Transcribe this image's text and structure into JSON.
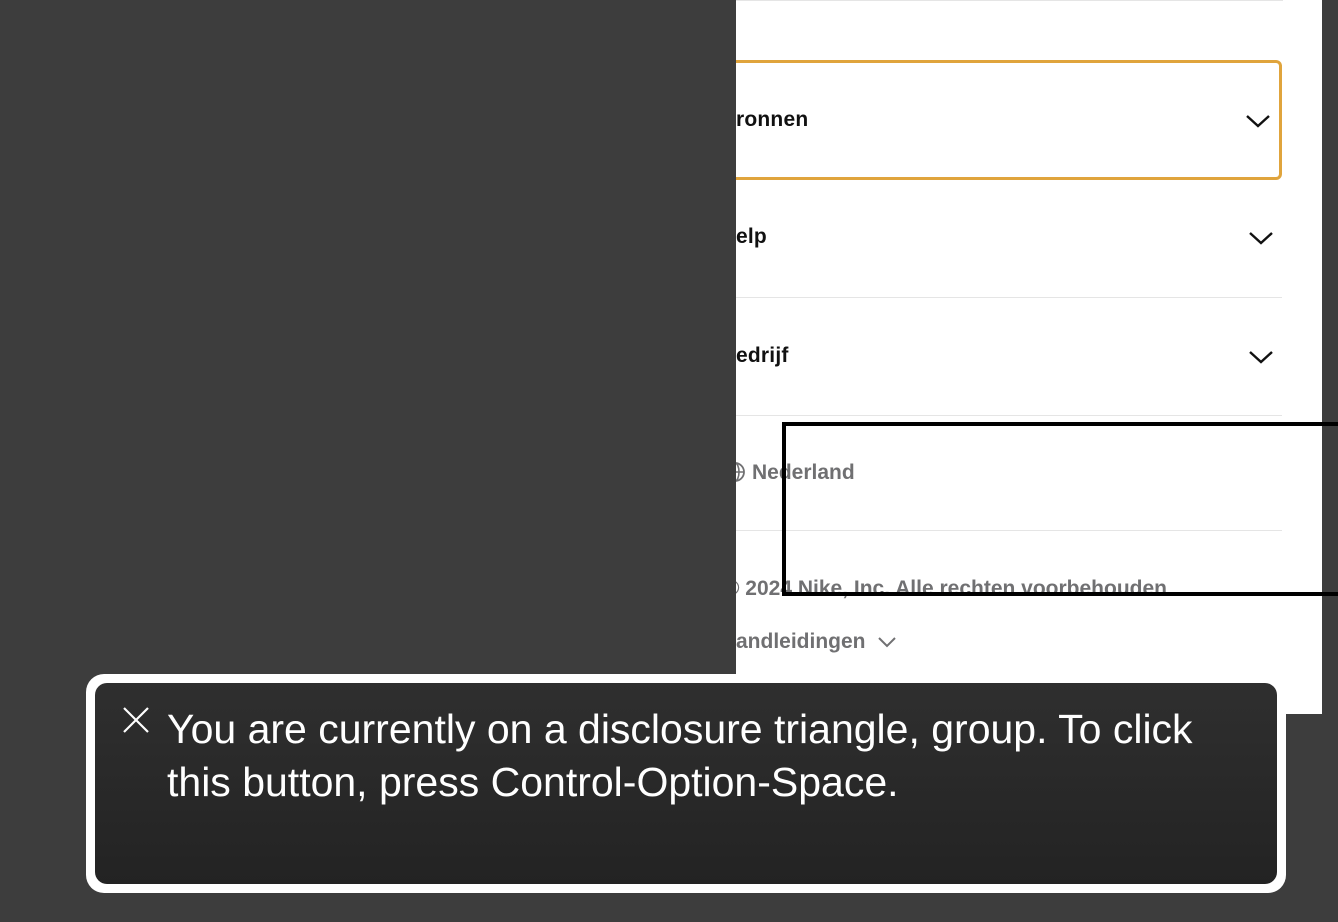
{
  "footer_panel": {
    "accordion": [
      {
        "label": "ronnen",
        "icon": "chevron-down-icon",
        "focused": true
      },
      {
        "label": "elp",
        "icon": "chevron-down-icon",
        "focused": false
      },
      {
        "label": "edrijf",
        "icon": "chevron-down-icon",
        "focused": false
      }
    ],
    "region": {
      "icon": "globe-icon",
      "label": "Nederland"
    },
    "copyright": "© 2024 Nike, Inc. Alle rechten voorbehouden",
    "guides": {
      "label": "andleidingen",
      "icon": "chevron-down-icon"
    }
  },
  "voiceover": {
    "close_icon": "close-icon",
    "message": "You are currently on a disclosure triangle, group. To click this button, press Control-Option-Space."
  },
  "colors": {
    "backdrop": "#3d3d3d",
    "focus_ring": "#e0a43c",
    "caption_bg": "#262626"
  }
}
